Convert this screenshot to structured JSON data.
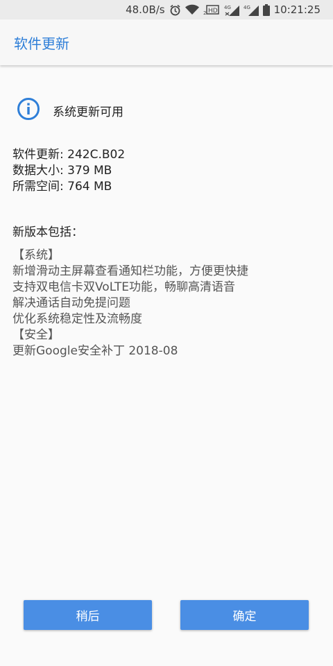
{
  "status_bar": {
    "speed": "48.0B/s",
    "time": "10:21:25",
    "icons": [
      "alarm-icon",
      "wifi-icon",
      "hd-icon",
      "signal-4g-icon",
      "signal-4g-icon",
      "battery-icon"
    ]
  },
  "app_bar": {
    "title": "软件更新"
  },
  "notice": {
    "text": "系统更新可用",
    "icon": "info-icon"
  },
  "update_info": {
    "version": "软件更新: 242C.B02",
    "size": "数据大小: 379 MB",
    "space": "所需空间: 764 MB"
  },
  "changes": {
    "title": "新版本包括：",
    "lines": [
      "【系统】",
      "新增滑动主屏幕查看通知栏功能，方便更快捷",
      "支持双电信卡双VoLTE功能，畅聊高清语音",
      "解决通话自动免提问题",
      "优化系统稳定性及流畅度",
      "【安全】",
      "更新Google安全补丁 2018-08"
    ]
  },
  "buttons": {
    "later": "稍后",
    "ok": "确定"
  },
  "colors": {
    "accent": "#2f7fd8",
    "button": "#4a8ee4"
  }
}
